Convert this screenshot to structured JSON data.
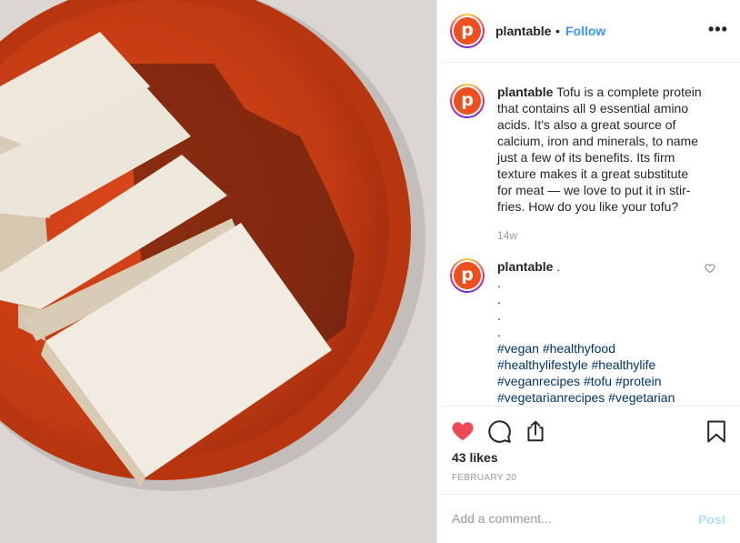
{
  "post": {
    "username": "plantable",
    "separator": "•",
    "follow_label": "Follow",
    "more_label": "•••",
    "avatar_letter": "p",
    "brand_color": "#ee4f1f",
    "link_color": "#3897f0"
  },
  "caption": {
    "username": "plantable",
    "text": "Tofu is a complete protein that contains all 9 essential amino acids. It's also a great source of calcium, iron and minerals, to name just a few of its benefits. Its firm texture makes it a great substitute for meat — we love to put it in stir-fries. How do you like your tofu?",
    "time": "14w"
  },
  "comment2": {
    "username": "plantable",
    "first_line": ".",
    "dots": [
      ".",
      ".",
      ".",
      "."
    ],
    "hashtag_lines": [
      "#vegan #healthyfood",
      "#healthylifestyle #healthylife",
      "#veganrecipes #tofu #protein",
      "#vegetarianrecipes #vegetarian"
    ]
  },
  "actions": {
    "icons": [
      "heart-filled-icon",
      "comment-bubble-icon",
      "share-icon",
      "bookmark-icon"
    ],
    "liked_color": "#ed4956",
    "likes": "43 likes",
    "date": "FEBRUARY 20"
  },
  "add_comment": {
    "placeholder": "Add a comment...",
    "post_label": "Post"
  }
}
